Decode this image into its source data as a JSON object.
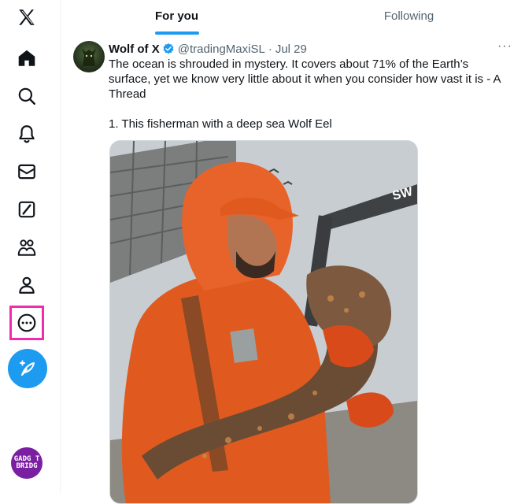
{
  "nav": {
    "items": [
      {
        "name": "x-logo-icon"
      },
      {
        "name": "home-icon"
      },
      {
        "name": "search-icon"
      },
      {
        "name": "notifications-icon"
      },
      {
        "name": "messages-icon"
      },
      {
        "name": "grok-icon"
      },
      {
        "name": "communities-icon"
      },
      {
        "name": "profile-icon"
      },
      {
        "name": "more-icon"
      }
    ],
    "highlight_color": "#f02bb0",
    "compose_color": "#1d9bf0",
    "profile_badge_line1": "GADG T",
    "profile_badge_line2": "BRIDG"
  },
  "tabs": [
    {
      "label": "For you",
      "active": true
    },
    {
      "label": "Following",
      "active": false
    }
  ],
  "tweet": {
    "name": "Wolf of X",
    "handle": "@tradingMaxiSL",
    "separator": "·",
    "date": "Jul 29",
    "more_label": "···",
    "text": "The ocean is shrouded in mystery. It covers about 71% of the Earth’s surface, yet we know very little about it when you consider how vast it is - A Thread\n\n1. This fisherman with a deep sea Wolf Eel",
    "media_alt": "Fisherman in orange rain gear holding a large wolf eel on a boat deck"
  },
  "colors": {
    "accent": "#1d9bf0",
    "text": "#0f1419",
    "secondary": "#536471"
  }
}
